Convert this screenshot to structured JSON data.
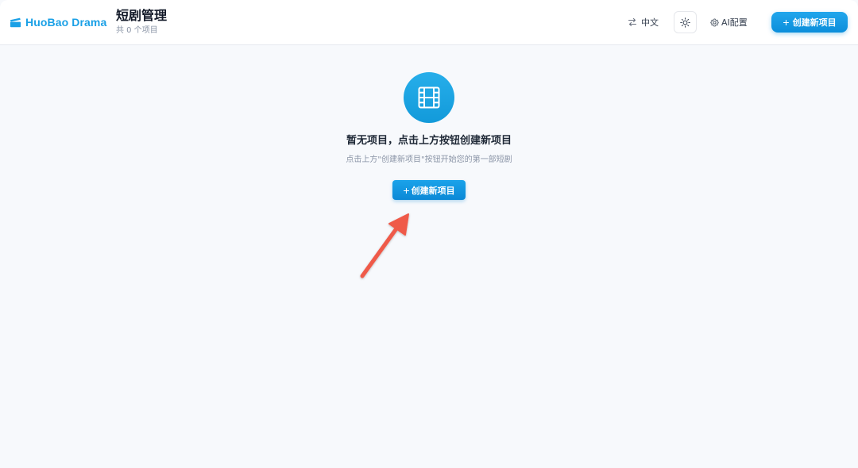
{
  "header": {
    "brand_name": "HuoBao Drama",
    "brand_icon": "clapperboard-icon",
    "title": "短剧管理",
    "subtitle": "共 0 个项目",
    "language_label": "中文",
    "language_icon": "translate-icon",
    "theme_icon": "sun-icon",
    "ai_config_label": "AI配置",
    "ai_config_icon": "gear-icon",
    "create_button_label": "创建新项目"
  },
  "empty_state": {
    "icon": "film-icon",
    "title": "暂无项目，点击上方按钮创建新项目",
    "description": "点击上方\"创建新项目\"按钮开始您的第一部短剧",
    "create_button_label": "创建新项目"
  },
  "colors": {
    "accent": "#1aa0e6",
    "background": "#f7f9fc",
    "annotation_arrow": "#ef5a4a"
  }
}
